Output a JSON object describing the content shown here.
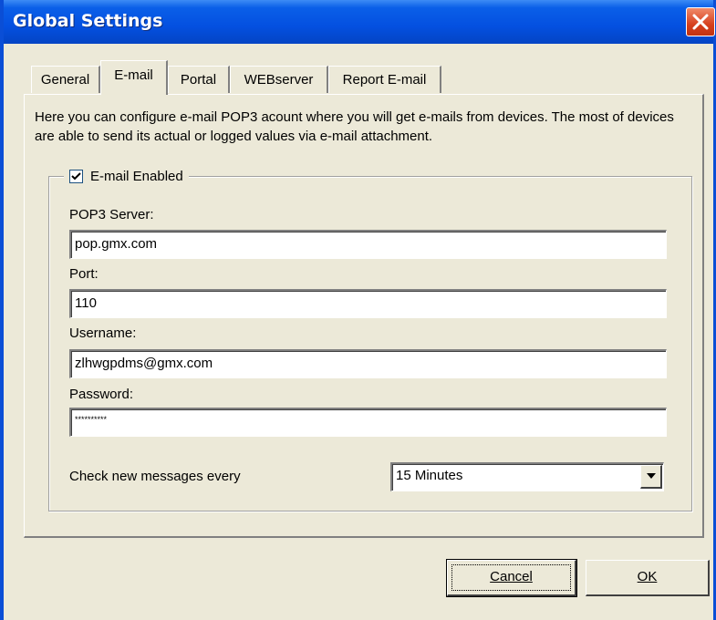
{
  "window": {
    "title": "Global Settings"
  },
  "tabs": [
    {
      "label": "General",
      "active": false
    },
    {
      "label": "E-mail",
      "active": true
    },
    {
      "label": "Portal",
      "active": false
    },
    {
      "label": "WEBserver",
      "active": false
    },
    {
      "label": "Report E-mail",
      "active": false
    }
  ],
  "email": {
    "description": "Here you can configure e-mail POP3 acount where you will get e-mails from devices. The most of devices are able to send its actual or logged values via e-mail attachment.",
    "enabled_label": "E-mail Enabled",
    "enabled": true,
    "pop3_label": "POP3 Server:",
    "pop3_value": "pop.gmx.com",
    "port_label": "Port:",
    "port_value": "110",
    "username_label": "Username:",
    "username_value": "zlhwgpdms@gmx.com",
    "password_label": "Password:",
    "password_value": "**********",
    "check_label": "Check new messages every",
    "check_value": "15 Minutes"
  },
  "buttons": {
    "cancel": "Cancel",
    "ok": "OK"
  },
  "colors": {
    "titlebar": "#0450e0",
    "dialog_bg": "#ece9d8",
    "close": "#d6401e"
  }
}
